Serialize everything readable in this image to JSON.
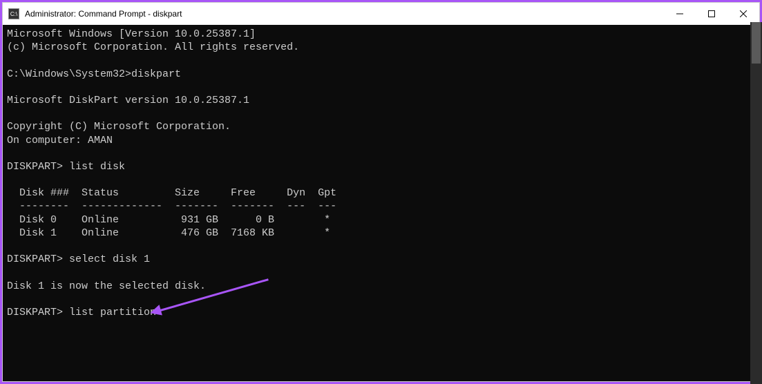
{
  "titlebar": {
    "icon_glyph": "C:\\",
    "title": "Administrator: Command Prompt - diskpart"
  },
  "terminal": {
    "lines": {
      "l0": "Microsoft Windows [Version 10.0.25387.1]",
      "l1": "(c) Microsoft Corporation. All rights reserved.",
      "l2": "",
      "l3": "C:\\Windows\\System32>diskpart",
      "l4": "",
      "l5": "Microsoft DiskPart version 10.0.25387.1",
      "l6": "",
      "l7": "Copyright (C) Microsoft Corporation.",
      "l8": "On computer: AMAN",
      "l9": "",
      "l10": "DISKPART> list disk",
      "l11": "",
      "l12": "  Disk ###  Status         Size     Free     Dyn  Gpt",
      "l13": "  --------  -------------  -------  -------  ---  ---",
      "l14": "  Disk 0    Online          931 GB      0 B        *",
      "l15": "  Disk 1    Online          476 GB  7168 KB        *",
      "l16": "",
      "l17": "DISKPART> select disk 1",
      "l18": "",
      "l19": "Disk 1 is now the selected disk.",
      "l20": "",
      "l21": "DISKPART> list partition"
    }
  }
}
